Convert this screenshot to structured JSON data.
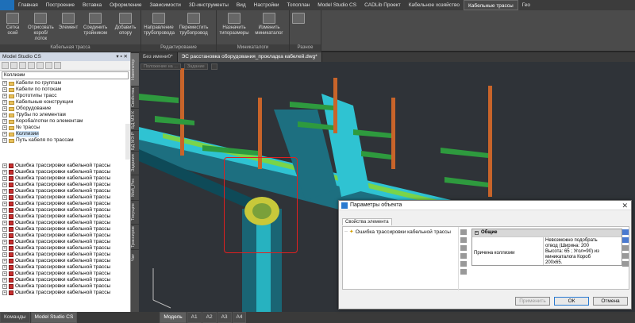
{
  "menu": [
    "Главная",
    "Построение",
    "Вставка",
    "Оформление",
    "Зависимости",
    "3D-инструменты",
    "Вид",
    "Настройки",
    "Топоплан",
    "Model Studio CS",
    "CADLib Проект",
    "Кабельное хозяйство",
    "Кабельные трассы",
    "Гео"
  ],
  "menu_active_index": 12,
  "ribbon": {
    "group1": {
      "label": "Кабельная трасса",
      "buttons": [
        "Сетка осей",
        "Отрисовать короб/лоток",
        "Элемент",
        "Соединить тройником",
        "Добавить опору"
      ]
    },
    "group2": {
      "label": "Редактирование",
      "buttons": [
        "Направление трубопровода",
        "Переместить трубопровод"
      ]
    },
    "group3": {
      "label": "Миникаталоги",
      "buttons": [
        "Назначить типоразмеры",
        "Изменить миникаталог"
      ]
    },
    "group4": {
      "label": "Разное",
      "buttons": [
        ""
      ]
    }
  },
  "left_panel": {
    "title": "Model Studio CS",
    "search_value": "Коллизии",
    "tree": [
      {
        "label": "Кабели по группам",
        "sel": false
      },
      {
        "label": "Кабели по потокам",
        "sel": false
      },
      {
        "label": "Прототипы трасс",
        "sel": false
      },
      {
        "label": "Кабельные конструкции",
        "sel": false
      },
      {
        "label": "Оборудование",
        "sel": false
      },
      {
        "label": "Трубы по элементам",
        "sel": false
      },
      {
        "label": "Короба/лотки по элементам",
        "sel": false
      },
      {
        "label": "№ трассы",
        "sel": false
      },
      {
        "label": "Коллизии",
        "sel": true
      },
      {
        "label": "Путь кабеля по трассам",
        "sel": false
      }
    ],
    "errors": [
      "Ошибка трассировки кабельной трассы",
      "Ошибка трассировки кабельной трассы",
      "Ошибка трассировки кабельной трассы",
      "Ошибка трассировки кабельной трассы",
      "Ошибка трассировки кабельной трассы",
      "Ошибка трассировки кабельной трассы",
      "Ошибка трассировки кабельной трассы",
      "Ошибка трассировки кабельной трассы",
      "Ошибка трассировки кабельной трассы",
      "Ошибка трассировки кабельной трассы",
      "Ошибка трассировки кабельной трассы",
      "Ошибка трассировки кабельной трассы",
      "Ошибка трассировки кабельной трассы",
      "Ошибка трассировки кабельной трассы",
      "Ошибка трассировки кабельной трассы",
      "Ошибка трассировки кабельной трассы",
      "Ошибка трассировки кабельной трассы",
      "Ошибка трассировки кабельной трассы",
      "Ошибка трассировки кабельной трассы",
      "Ошибка трассировки кабельной трассы",
      "Ошибка трассировки кабельной трассы"
    ]
  },
  "vtabs": [
    "Навигатор",
    "Свойства",
    "БД МЭ К",
    "БД МЭ Р",
    "Задания",
    "Мой_Рос",
    "Текущие",
    "Трассиров",
    "Чат"
  ],
  "doc_tabs": [
    "Без имени0*",
    "ЭС расстановка оборудования_прокладка кабелей.dwg*"
  ],
  "view_header": [
    "Положение на ...",
    "Задание",
    ""
  ],
  "status_tabs": [
    "Команды",
    "Model Studio CS",
    "Модель",
    "A1",
    "A2",
    "A3",
    "A4"
  ],
  "dialog": {
    "title": "Параметры объекта",
    "subtab": "Свойства элемента",
    "tree_item": "Ошибка трассировки кабельной трассы",
    "section": "Общие",
    "prop_name": "Причина коллизии",
    "prop_value": "Невозможно подобрать\nотвод (Ширина: 200\nВысота: 65 ; Угол=90) из\nминикаталога Короб\n200х65.",
    "btn_apply": "Применить",
    "btn_ok": "ОК",
    "btn_cancel": "Отмена"
  },
  "colors": {
    "accent": "#1e6fb8",
    "collision_box": "#e02020",
    "tray_cyan": "#29c5d6",
    "support_green": "#2e9a3e",
    "post_orange": "#c8642a"
  }
}
